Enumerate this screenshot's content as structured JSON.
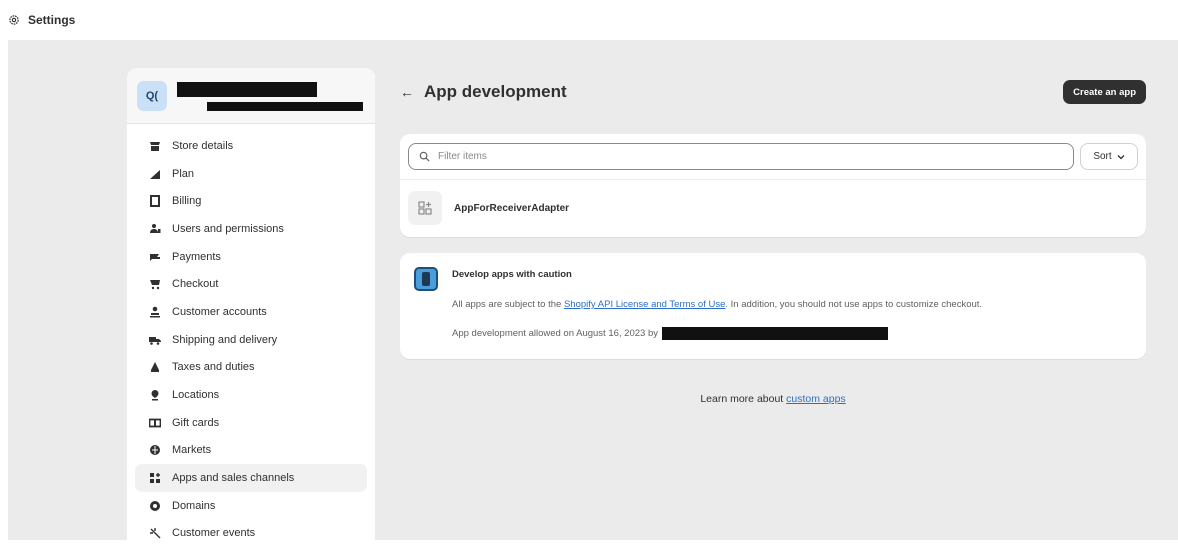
{
  "topbar": {
    "title": "Settings",
    "icon": "gear-icon"
  },
  "sidebar": {
    "store": {
      "avatar_initials": "Q("
    },
    "items": [
      {
        "label": "Store details",
        "icon": "store-icon"
      },
      {
        "label": "Plan",
        "icon": "chart-icon"
      },
      {
        "label": "Billing",
        "icon": "receipt-icon"
      },
      {
        "label": "Users and permissions",
        "icon": "users-icon"
      },
      {
        "label": "Payments",
        "icon": "payments-icon"
      },
      {
        "label": "Checkout",
        "icon": "cart-icon"
      },
      {
        "label": "Customer accounts",
        "icon": "person-icon"
      },
      {
        "label": "Shipping and delivery",
        "icon": "truck-icon"
      },
      {
        "label": "Taxes and duties",
        "icon": "tax-icon"
      },
      {
        "label": "Locations",
        "icon": "location-pin-icon"
      },
      {
        "label": "Gift cards",
        "icon": "gift-card-icon"
      },
      {
        "label": "Markets",
        "icon": "globe-icon"
      },
      {
        "label": "Apps and sales channels",
        "icon": "apps-icon",
        "active": true
      },
      {
        "label": "Domains",
        "icon": "domain-globe-icon"
      },
      {
        "label": "Customer events",
        "icon": "events-icon"
      }
    ]
  },
  "main": {
    "title": "App development",
    "create_button": "Create an app",
    "filter": {
      "placeholder": "Filter items"
    },
    "sort_label": "Sort",
    "apps": [
      {
        "name": "AppForReceiverAdapter"
      }
    ],
    "banner": {
      "title": "Develop apps with caution",
      "text_before": "All apps are subject to the ",
      "link": "Shopify API License and Terms of Use",
      "text_after": ". In addition, you should not use apps to customize checkout.",
      "allowed_text": "App development allowed on August 16, 2023 by"
    },
    "footer": {
      "text": "Learn more about ",
      "link": "custom apps"
    }
  }
}
